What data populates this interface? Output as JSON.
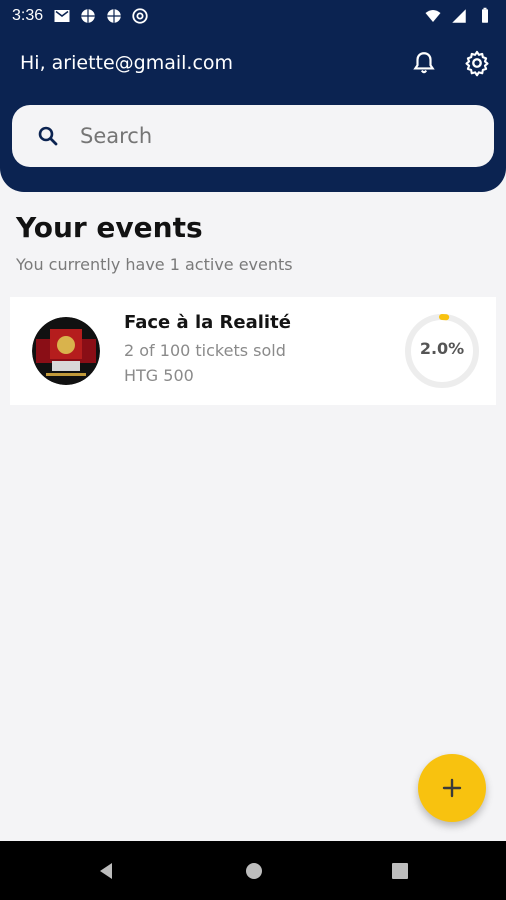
{
  "status_bar": {
    "time": "3:36",
    "left_icons": [
      "gmail-icon",
      "basketball-icon",
      "basketball-icon",
      "at-icon"
    ],
    "right_icons": [
      "wifi-icon",
      "signal-icon",
      "battery-icon"
    ]
  },
  "header": {
    "greeting": "Hi, ariette@gmail.com",
    "bell_icon": "bell-icon",
    "settings_icon": "gear-icon",
    "search_placeholder": "Search"
  },
  "events_section": {
    "title": "Your events",
    "subtitle": "You currently have 1 active events"
  },
  "events": [
    {
      "title": "Face à la Realité",
      "sold_text": "2 of 100 tickets sold",
      "price": "HTG 500",
      "progress_label": "2.0%",
      "progress_fraction": 0.02
    }
  ],
  "fab": {
    "icon": "plus-icon"
  },
  "colors": {
    "primary": "#0b2351",
    "accent": "#f8c20f",
    "background": "#f4f4f6"
  }
}
